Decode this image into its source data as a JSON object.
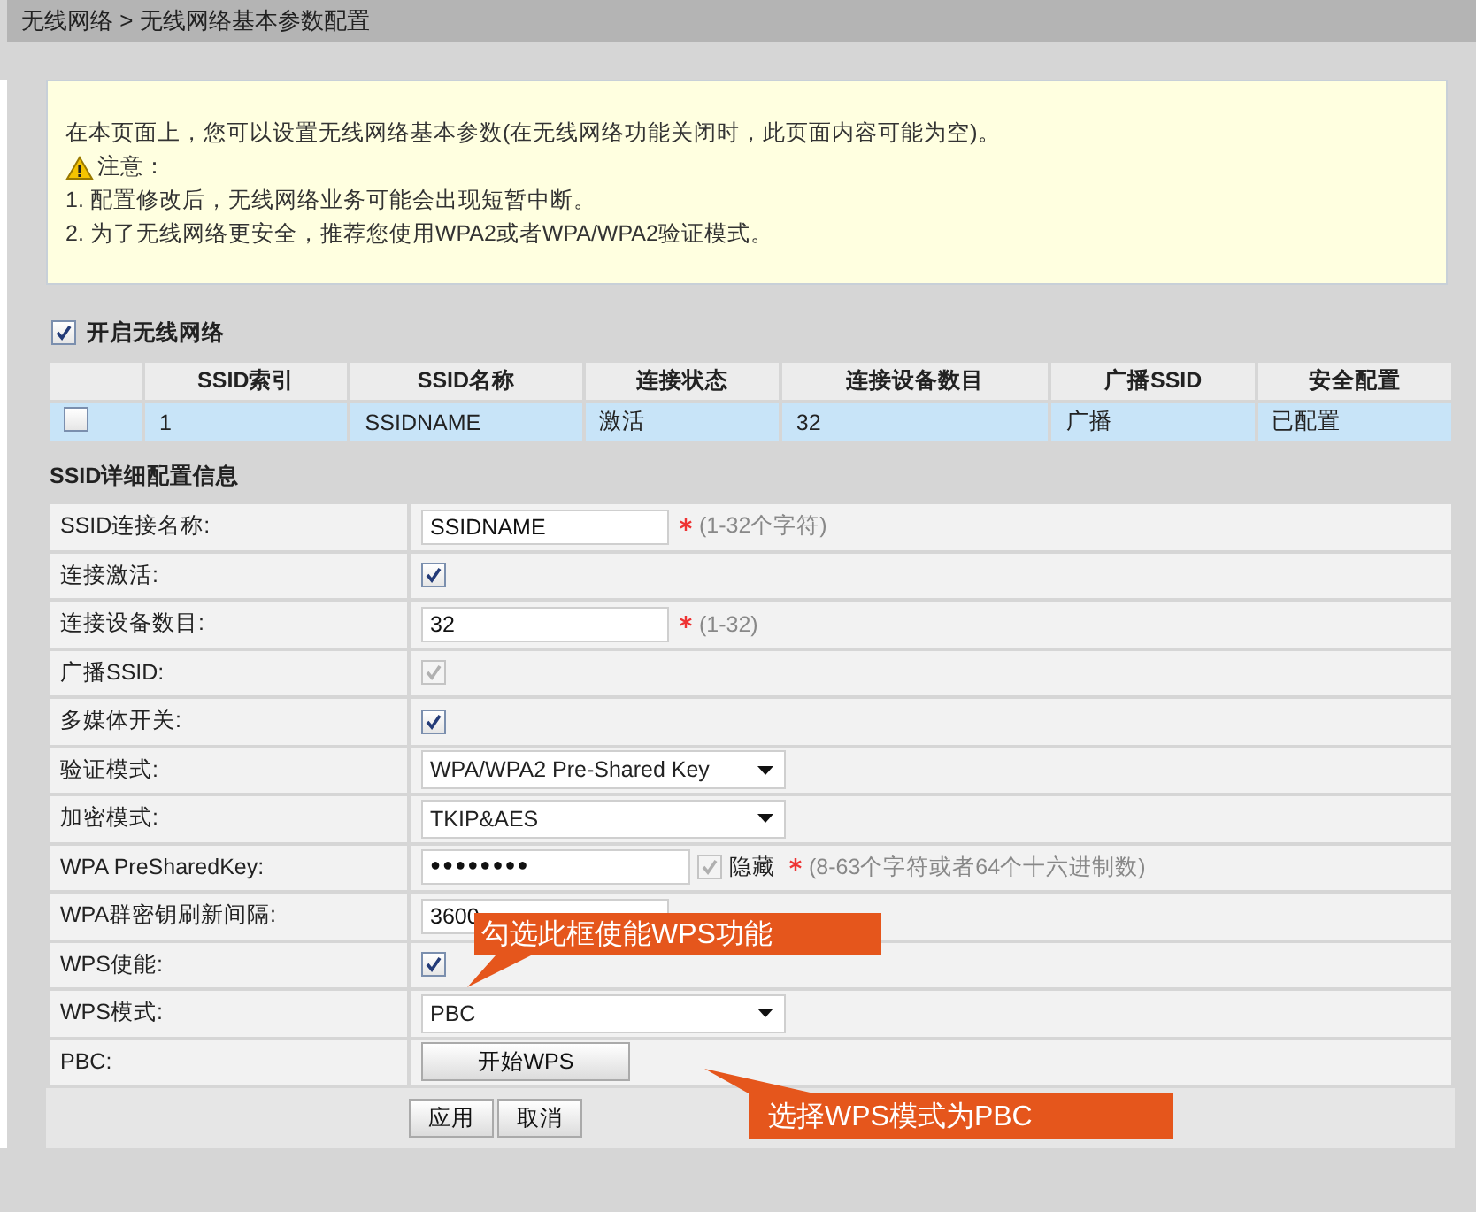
{
  "breadcrumb": "无线网络 > 无线网络基本参数配置",
  "notice": [
    {
      "kind": "text",
      "text": "在本页面上，您可以设置无线网络基本参数(在无线网络功能关闭时，此页面内容可能为空)。"
    },
    {
      "kind": "warning",
      "text": "注意："
    },
    {
      "kind": "text",
      "text": "1. 配置修改后，无线网络业务可能会出现短暂中断。"
    },
    {
      "kind": "text",
      "text": "2. 为了无线网络更安全，推荐您使用WPA2或者WPA/WPA2验证模式。"
    }
  ],
  "enable_wireless": {
    "label": "开启无线网络",
    "checked": true
  },
  "ssid_table": {
    "columns": [
      "SSID索引",
      "SSID名称",
      "连接状态",
      "连接设备数目",
      "广播SSID",
      "安全配置"
    ],
    "rows": [
      {
        "checked": false,
        "selected": true,
        "cells": [
          "1",
          "SSIDNAME",
          "激活",
          "32",
          "广播",
          "已配置"
        ]
      }
    ]
  },
  "details": {
    "title": "SSID详细配置信息",
    "rows": [
      {
        "kind": "text",
        "label": "SSID连接名称:",
        "value": "SSIDNAME",
        "required": true,
        "hint": "(1-32个字符)"
      },
      {
        "kind": "checkbox",
        "label": "连接激活:",
        "checked": true,
        "disabled": false
      },
      {
        "kind": "text",
        "label": "连接设备数目:",
        "value": "32",
        "required": true,
        "hint": "(1-32)"
      },
      {
        "kind": "checkbox",
        "label": "广播SSID:",
        "checked": true,
        "disabled": true
      },
      {
        "kind": "checkbox",
        "label": "多媒体开关:",
        "checked": true,
        "disabled": false
      },
      {
        "kind": "select",
        "label": "验证模式:",
        "value": "WPA/WPA2 Pre-Shared Key"
      },
      {
        "kind": "select",
        "label": "加密模式:",
        "value": "TKIP&AES"
      },
      {
        "kind": "password",
        "label": "WPA PreSharedKey:",
        "value": "●●●●●●●●",
        "hide_label": "隐藏",
        "hide_checked": true,
        "hide_disabled": true,
        "required": true,
        "hint": "(8-63个字符或者64个十六进制数)"
      },
      {
        "kind": "text",
        "label": "WPA群密钥刷新间隔:",
        "value": "3600"
      },
      {
        "kind": "checkbox",
        "label": "WPS使能:",
        "checked": true,
        "disabled": false
      },
      {
        "kind": "select",
        "label": "WPS模式:",
        "value": "PBC"
      },
      {
        "kind": "button",
        "label": "PBC:",
        "button": "开始WPS"
      }
    ],
    "buttons": [
      "应用",
      "取消"
    ]
  },
  "annotations": [
    {
      "kind": "up",
      "text": "勾选此框使能WPS功能"
    },
    {
      "kind": "down",
      "text": "选择WPS模式为PBC"
    }
  ]
}
